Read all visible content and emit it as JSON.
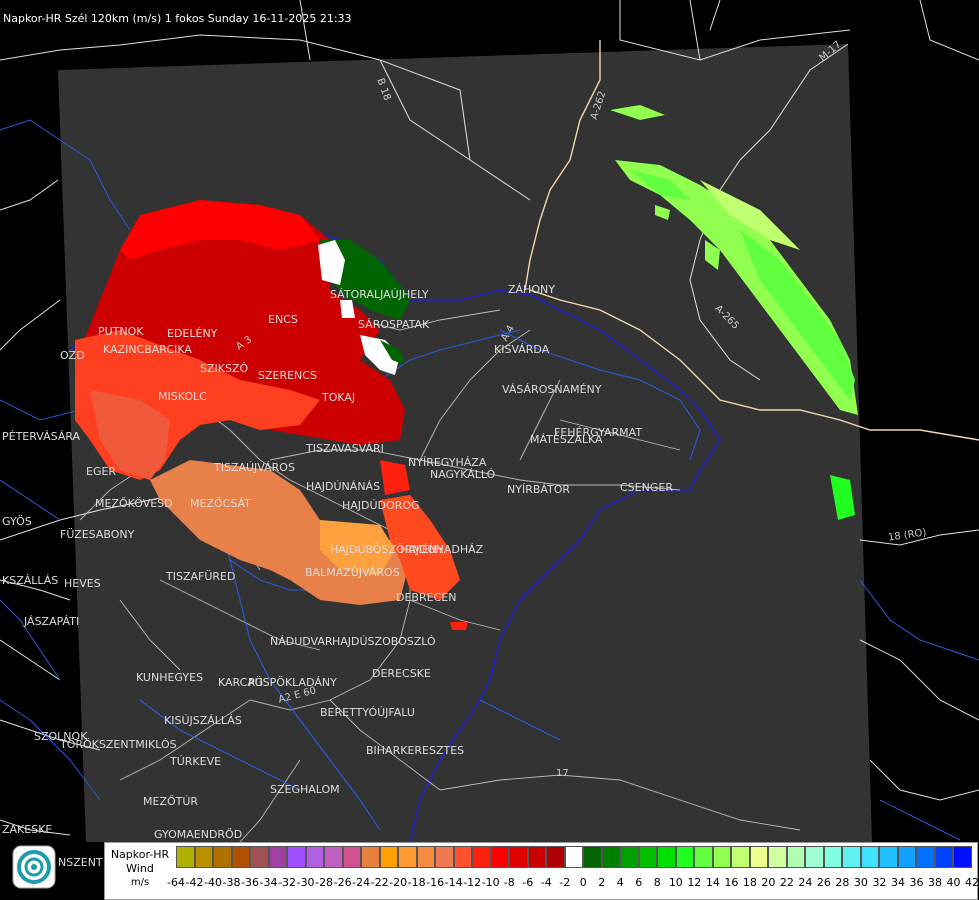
{
  "title": "Napkor-HR Szél 120km (m/s) 1 fokos Sunday 16-11-2025 21:33",
  "legend": {
    "name": "Napkor-HR",
    "quantity": "Wind",
    "unit": "m/s",
    "ticks": [
      "-64",
      "-42",
      "-40",
      "-38",
      "-36",
      "-34",
      "-32",
      "-30",
      "-28",
      "-26",
      "-24",
      "-22",
      "-20",
      "-18",
      "-16",
      "-14",
      "-12",
      "-10",
      "-8",
      "-6",
      "-4",
      "-2",
      "0",
      "2",
      "4",
      "6",
      "8",
      "10",
      "12",
      "14",
      "16",
      "18",
      "20",
      "22",
      "24",
      "26",
      "28",
      "30",
      "32",
      "34",
      "36",
      "38",
      "40",
      "42"
    ],
    "colors": [
      "#b0b000",
      "#b89000",
      "#b07000",
      "#b05000",
      "#a05050",
      "#a040a0",
      "#a050ff",
      "#b060e0",
      "#c060c0",
      "#d05090",
      "#e88040",
      "#ffa000",
      "#ff9a30",
      "#f58a40",
      "#f07850",
      "#ff5030",
      "#ff2010",
      "#ff0000",
      "#e00000",
      "#c80000",
      "#b00000",
      "#ffffff",
      "#006400",
      "#008000",
      "#00a000",
      "#00c000",
      "#00e000",
      "#20ff20",
      "#60ff40",
      "#90ff50",
      "#c0ff70",
      "#f0ff90",
      "#d0ffa0",
      "#b0ffb0",
      "#a0ffd0",
      "#80ffe0",
      "#60f0f0",
      "#40e0ff",
      "#20c0ff",
      "#10a0ff",
      "#0070ff",
      "#0040ff",
      "#0010ff"
    ]
  },
  "map": {
    "background": "#000000",
    "coverage_color": "#333333",
    "river_color": "#2a5bd7",
    "border_color": "#2222cc",
    "road_color": "#e0e0e0",
    "highway_color": "#f0d8b0",
    "cities": [
      "SÁTORALJAÚJHELY",
      "SÁROSPATAK",
      "ZÁHONY",
      "KISVÁRDA",
      "VÁSÁROSNAMÉNY",
      "FEHÉRGYARMAT",
      "MÁTÉSZALKA",
      "CSENGER",
      "NYÍRBÁTOR",
      "NAGYKÁLLÓ",
      "NYÍREGYHÁZA",
      "TISZAVASVÁRI",
      "TOKAJ",
      "SZERENCS",
      "SZIKSZÓ",
      "ENCS",
      "EDELÉNY",
      "PUTNOK",
      "KAZINCBARCIKA",
      "MISKOLC",
      "TISZAÚJVÁROS",
      "HAJDÚNÁNÁS",
      "HAJDÚDOROG",
      "HAJDÚBÖSZÖRMÉNY",
      "HAJDÚHADHÁZ",
      "BALMAZÚJVÁROS",
      "DEBRECEN",
      "EGER",
      "MEZŐKÖVESD",
      "MEZŐCSÁT",
      "FÜZESABONY",
      "HEVES",
      "TISZAFÜRED",
      "NÁDUDVAR",
      "HAJDÚSZOBOSZLÓ",
      "DERECSKE",
      "KUNHEGYES",
      "KARCAG",
      "PÜSPÖKLADÁNY",
      "KISÚJSZÁLLÁS",
      "BERETTYÓÚJFALU",
      "BIHARKERESZTES",
      "TÖRÖKSZENTMIKLÓS",
      "SZOLNOK",
      "TÚRKEVE",
      "SZEGHALOM",
      "MEZŐTÚR",
      "GYOMAENDRŐD",
      "PÉTERVÁSÁRA",
      "GYÖS",
      "JÁSZAPÁTI",
      "KSZÁLLÁS",
      "OZD",
      "ZAKESKE",
      "NSZENT"
    ],
    "roads": [
      "B 18",
      "A-262",
      "M-17",
      "A-265",
      "A 4",
      "18 (RO)",
      "A 3",
      "A2 E 60",
      "17"
    ]
  }
}
